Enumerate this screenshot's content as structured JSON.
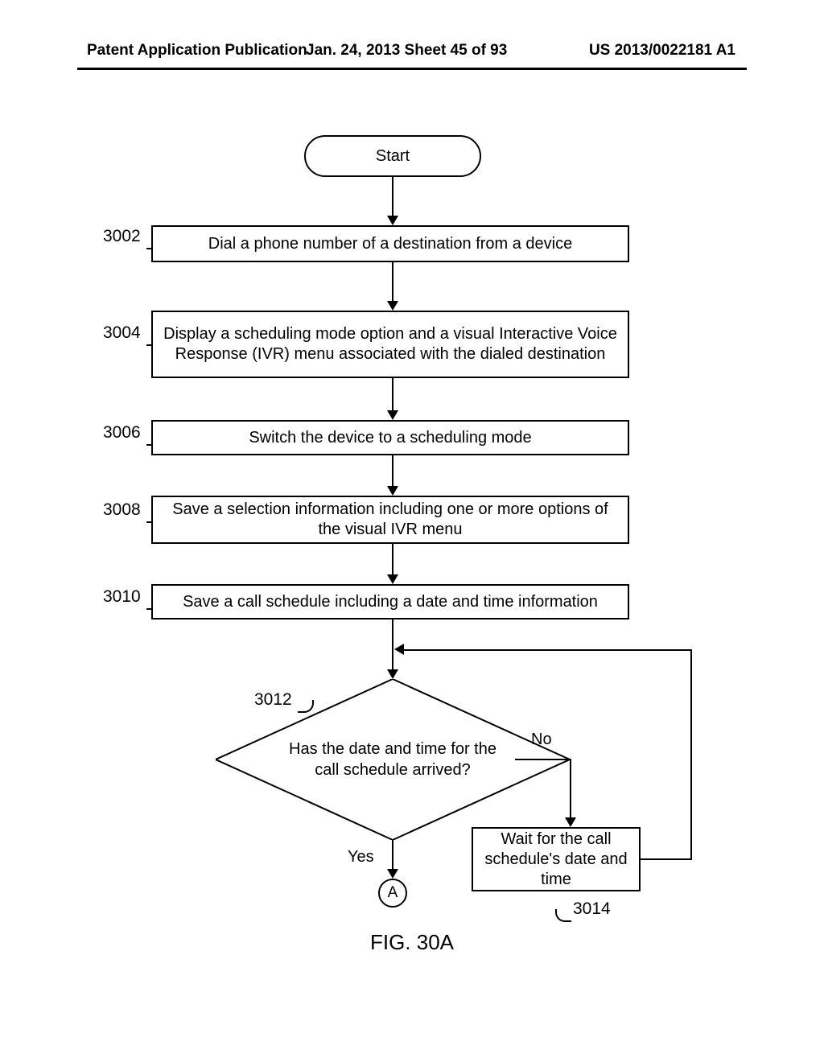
{
  "header": {
    "left": "Patent Application Publication",
    "mid": "Jan. 24, 2013  Sheet 45 of 93",
    "right": "US 2013/0022181 A1"
  },
  "refs": {
    "r3002": "3002",
    "r3004": "3004",
    "r3006": "3006",
    "r3008": "3008",
    "r3010": "3010",
    "r3012": "3012",
    "r3014": "3014"
  },
  "nodes": {
    "start": "Start",
    "b3002": "Dial a phone number of a destination from a device",
    "b3004": "Display a scheduling mode option and a visual Interactive Voice Response (IVR) menu  associated with the dialed destination",
    "b3006": "Switch the device to a scheduling mode",
    "b3008": "Save a selection information including one or more options of the visual IVR menu",
    "b3010": "Save a call schedule including a date and time information",
    "d3012": "Has the date and time for the call schedule arrived?",
    "wait": "Wait for the call schedule's date and time",
    "yes": "Yes",
    "no": "No",
    "connA": "A"
  },
  "caption": "FIG. 30A"
}
